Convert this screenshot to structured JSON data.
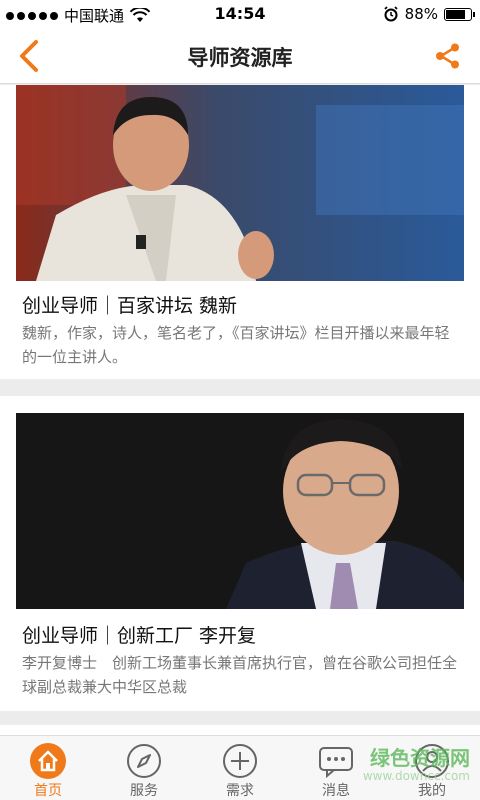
{
  "status": {
    "carrier": "中国联通",
    "time": "14:54",
    "battery": "88%",
    "battery_level": 0.88
  },
  "nav": {
    "title": "导师资源库",
    "accent": "#f07a1a"
  },
  "cards": [
    {
      "title": "创业导师｜百家讲坛 魏新",
      "desc": "魏新，作家，诗人，笔名老了，《百家讲坛》栏目开播以来最年轻的一位主讲人。"
    },
    {
      "title": "创业导师｜创新工厂 李开复",
      "desc": "李开复博士　创新工场董事长兼首席执行官，曾在谷歌公司担任全球副总裁兼大中华区总裁"
    }
  ],
  "tabs": [
    {
      "label": "首页",
      "icon": "home-icon",
      "active": true
    },
    {
      "label": "服务",
      "icon": "compass-icon"
    },
    {
      "label": "需求",
      "icon": "plus-circle-icon"
    },
    {
      "label": "消息",
      "icon": "chat-icon"
    },
    {
      "label": "我的",
      "icon": "user-icon"
    }
  ],
  "watermark": {
    "main": "绿色资源网",
    "sub": "www.downcc.com"
  }
}
